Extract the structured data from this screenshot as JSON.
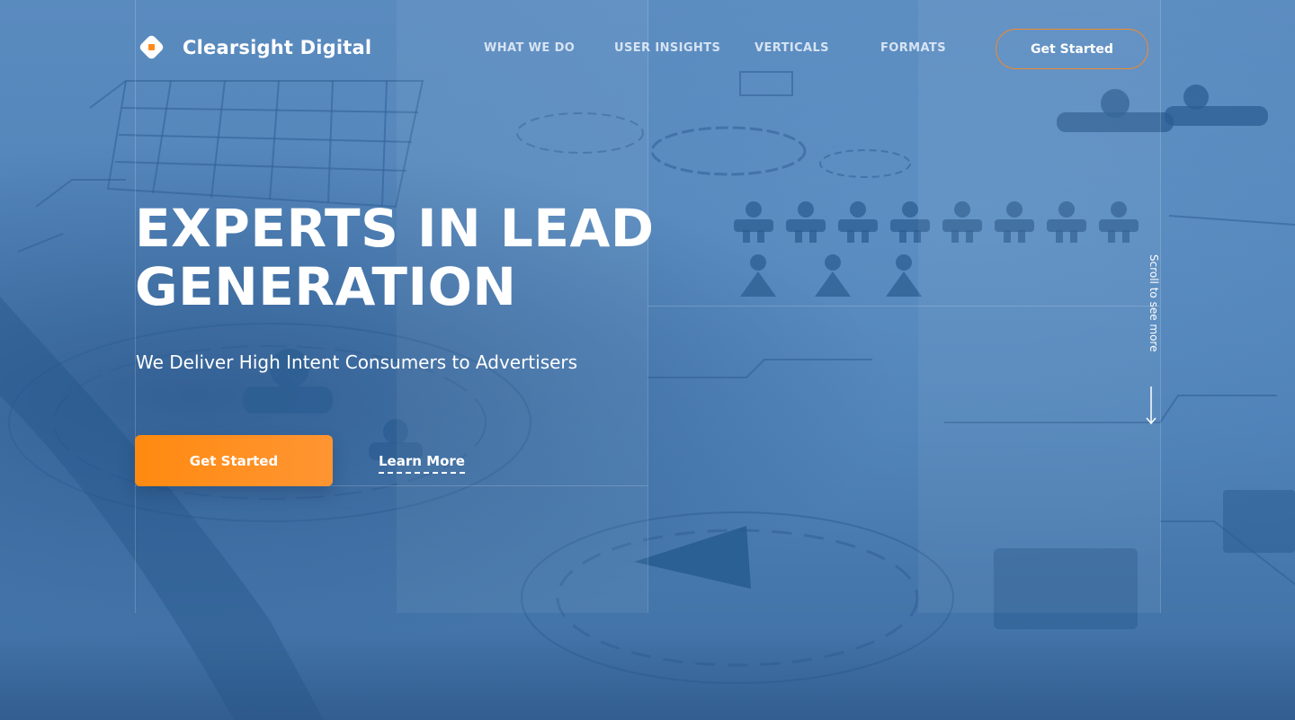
{
  "brand": {
    "name": "Clearsight Digital",
    "logo_icon": "diamond-logo-icon",
    "accent_color": "#ff8a1e"
  },
  "nav": {
    "items": [
      {
        "label": "WHAT WE DO"
      },
      {
        "label": "USER INSIGHTS"
      },
      {
        "label": "VERTICALS"
      },
      {
        "label": "FORMATS"
      }
    ],
    "cta_label": "Get Started"
  },
  "hero": {
    "headline_line1": "EXPERTS IN LEAD",
    "headline_line2": "GENERATION",
    "subheadline": "We Deliver High Intent Consumers to Advertisers",
    "primary_cta": "Get Started",
    "secondary_cta": "Learn More"
  },
  "scroll_hint": {
    "label": "Scroll to see more",
    "icon": "arrow-down-icon"
  },
  "colors": {
    "background": "#4f82b8",
    "text": "#ffffff",
    "button_orange": "#ff8a10"
  }
}
